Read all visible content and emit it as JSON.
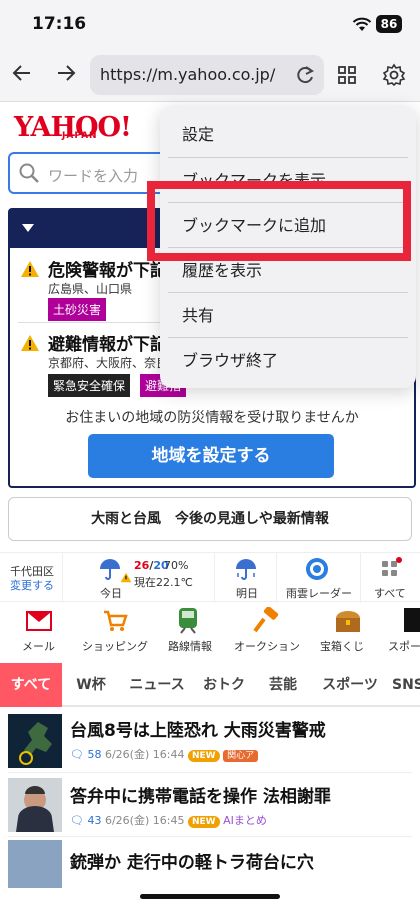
{
  "status": {
    "time": "17:16",
    "battery": "86"
  },
  "browser": {
    "url": "https://m.yahoo.co.jp/"
  },
  "logo": {
    "name": "YAHOO!",
    "sub": "JAPAN"
  },
  "search": {
    "placeholder": "ワードを入力"
  },
  "alerts": {
    "items": [
      {
        "title": "危険警報が下記",
        "regions": "広島県、山口県",
        "tags": [
          "土砂災害"
        ]
      },
      {
        "title": "避難情報が下記",
        "regions": "京都府、大阪府、奈良",
        "tags": [
          "緊急安全確保",
          "避難指"
        ]
      }
    ],
    "ask": "お住まいの地域の防災情報を受け取りませんか",
    "button": "地域を設定する"
  },
  "news_link": "大雨と台風　今後の見通しや最新情報",
  "weather": {
    "location": "千代田区",
    "change": "変更する",
    "today": "今日",
    "high": "26",
    "low": "20",
    "rain": "70%",
    "now": "現在22.1℃",
    "tomorrow": "明日",
    "radar": "雨雲レーダー",
    "all": "すべて"
  },
  "services": [
    "メール",
    "ショッピング",
    "路線情報",
    "オークション",
    "宝箱くじ",
    "スポー"
  ],
  "tabs": [
    "すべて",
    "W杯",
    "ニュース",
    "おトク",
    "芸能",
    "スポーツ",
    "SNS"
  ],
  "news": [
    {
      "title": "台風8号は上陸恐れ 大雨災害警戒",
      "comments": "58",
      "date": "6/26(金) 16:44",
      "new": "NEW",
      "extra": "関心ア"
    },
    {
      "title": "答弁中に携帯電話を操作 法相謝罪",
      "comments": "43",
      "date": "6/26(金) 16:45",
      "new": "NEW",
      "extra": "AIまとめ"
    },
    {
      "title": "銃弾か 走行中の軽トラ荷台に穴",
      "comments": "",
      "date": "",
      "new": "",
      "extra": ""
    }
  ],
  "menu": {
    "items": [
      "設定",
      "ブックマークを表示",
      "ブックマークに追加",
      "履歴を表示",
      "共有",
      "ブラウザ終了"
    ]
  },
  "colors": {
    "brand": "#e0001e",
    "highlight": "#e8253a",
    "navy": "#162358",
    "blue": "#2a7de1",
    "tab_active": "#ff5864"
  }
}
